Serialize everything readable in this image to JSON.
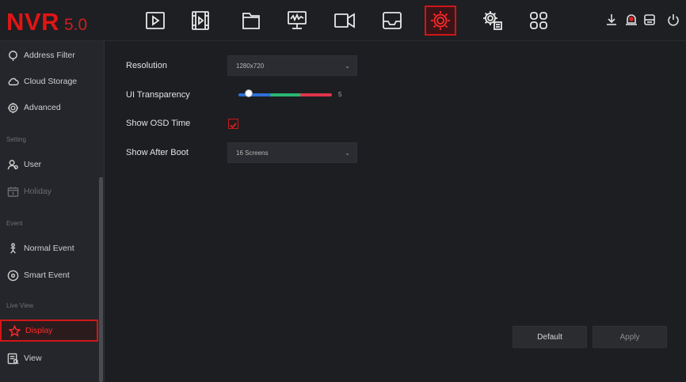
{
  "app": {
    "brand": "NVR",
    "version": "5.0"
  },
  "topnav": [
    {
      "icon": "playback-icon"
    },
    {
      "icon": "video-clip-icon"
    },
    {
      "icon": "folder-icon"
    },
    {
      "icon": "monitor-icon"
    },
    {
      "icon": "camera-icon"
    },
    {
      "icon": "tray-icon"
    },
    {
      "icon": "settings-gear-icon",
      "active": true
    },
    {
      "icon": "maintenance-gear-icon"
    },
    {
      "icon": "grid-apps-icon"
    }
  ],
  "status_icons": [
    "download-icon",
    "alarm-icon",
    "storage-icon",
    "power-icon"
  ],
  "sidebar": {
    "items": [
      {
        "label": "Address Filter",
        "icon": "filter-icon"
      },
      {
        "label": "Cloud Storage",
        "icon": "cloud-icon"
      },
      {
        "label": "Advanced",
        "icon": "advanced-gear-icon"
      },
      {
        "label": "User",
        "icon": "user-icon"
      },
      {
        "label": "Holiday",
        "icon": "calendar-icon",
        "disabled": true
      },
      {
        "label": "Normal Event",
        "icon": "event-icon"
      },
      {
        "label": "Smart Event",
        "icon": "smart-event-icon"
      },
      {
        "label": "Display",
        "icon": "star-icon",
        "active": true
      },
      {
        "label": "View",
        "icon": "view-icon"
      }
    ],
    "headers": {
      "setting": "Setting",
      "event": "Event",
      "live_view": "Live View"
    }
  },
  "form": {
    "resolution": {
      "label": "Resolution",
      "value": "1280x720"
    },
    "ui_transparency": {
      "label": "UI Transparency",
      "value": "5",
      "level": 0.05
    },
    "show_osd_time": {
      "label": "Show OSD Time",
      "checked": true
    },
    "show_after_boot": {
      "label": "Show After Boot",
      "value": "16 Screens"
    }
  },
  "buttons": {
    "default": "Default",
    "apply": "Apply"
  },
  "colors": {
    "accent": "#d01616",
    "slider_blue": "#2f6fd6",
    "slider_green": "#2bb673",
    "slider_red": "#e0354a"
  }
}
